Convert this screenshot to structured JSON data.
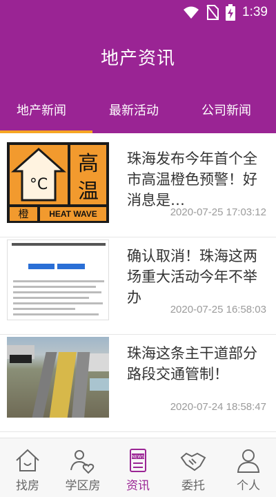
{
  "status_bar": {
    "time": "1:39"
  },
  "header": {
    "title": "地产资讯"
  },
  "tabs": [
    {
      "label": "地产新闻",
      "active": true
    },
    {
      "label": "最新活动",
      "active": false
    },
    {
      "label": "公司新闻",
      "active": false
    }
  ],
  "news": [
    {
      "title": "珠海发布今年首个全市高温橙色预警！好消息是…",
      "time": "2020-07-25 17:03:12",
      "thumb": {
        "line1": "高",
        "line2": "温",
        "bottom_left": "橙",
        "bottom_right": "HEAT WAVE"
      }
    },
    {
      "title": "确认取消！珠海这两场重大活动今年不举办",
      "time": "2020-07-25 16:58:03"
    },
    {
      "title": "珠海这条主干道部分路段交通管制！",
      "time": "2020-07-24 18:58:47"
    }
  ],
  "bottom_nav": [
    {
      "label": "找房",
      "icon": "house-icon",
      "active": false
    },
    {
      "label": "学区房",
      "icon": "school-district-icon",
      "active": false
    },
    {
      "label": "资讯",
      "icon": "news-icon",
      "active": true
    },
    {
      "label": "委托",
      "icon": "handshake-icon",
      "active": false
    },
    {
      "label": "个人",
      "icon": "person-icon",
      "active": false
    }
  ],
  "colors": {
    "brand": "#9a2494",
    "tab_indicator": "#f5a623",
    "heat_orange": "#f29a2e"
  }
}
